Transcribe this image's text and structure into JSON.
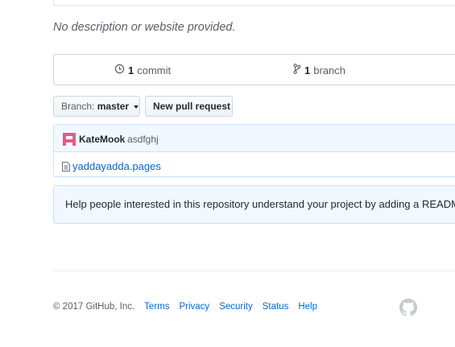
{
  "repo": {
    "description": "No description or website provided."
  },
  "summary": {
    "commits_count": "1",
    "commits_label": "commit",
    "branches_count": "1",
    "branches_label": "branch"
  },
  "toolbar": {
    "branch_label": "Branch:",
    "branch_value": "master",
    "new_pr_label": "New pull request"
  },
  "latest_commit": {
    "author": "KateMook",
    "message": "asdfghj"
  },
  "files": [
    {
      "name": "yaddayadda.pages",
      "icon": "file-icon"
    }
  ],
  "readme_prompt": "Help people interested in this repository understand your project by adding a README.",
  "footer": {
    "copyright": "© 2017 GitHub, Inc.",
    "links": [
      "Terms",
      "Privacy",
      "Security",
      "Status",
      "Help"
    ],
    "logo": "github-logo-icon"
  }
}
